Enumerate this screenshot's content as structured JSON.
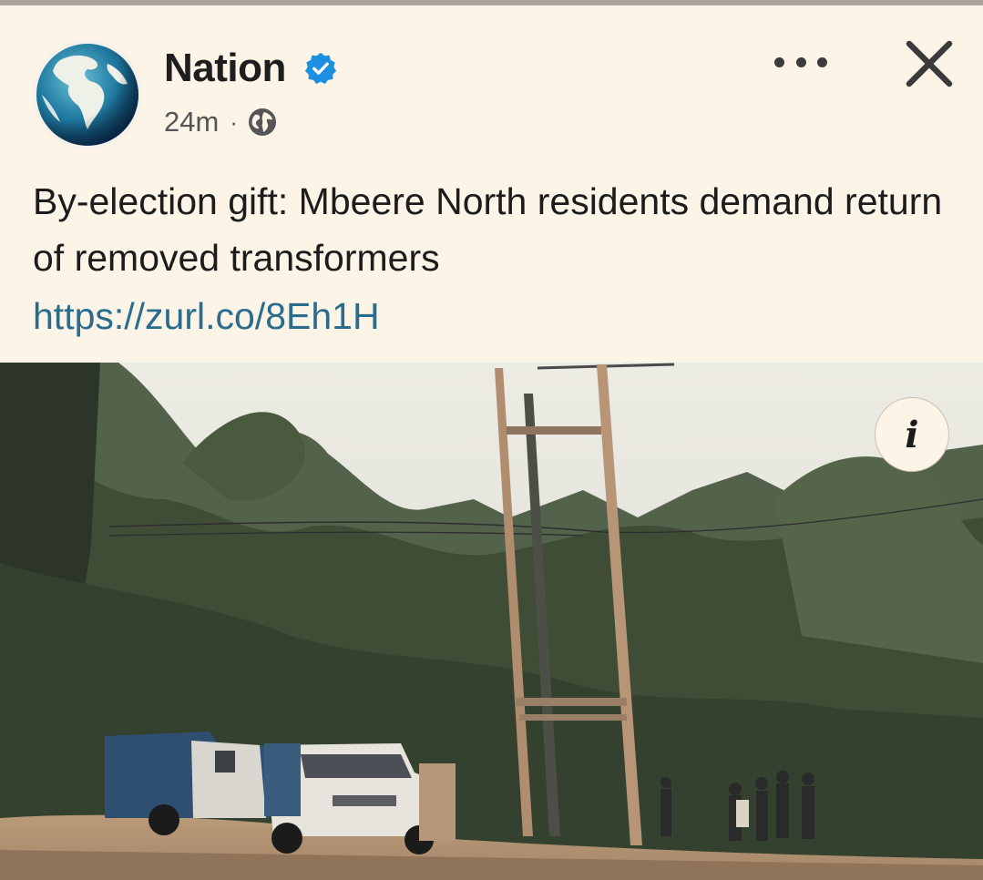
{
  "post": {
    "page_name": "Nation",
    "verified": true,
    "time_ago": "24m",
    "separator": "·",
    "audience_icon": "globe-icon",
    "text": "By-election gift: Mbeere North residents demand return of removed transformers",
    "link": "https://zurl.co/8Eh1H"
  },
  "header_actions": {
    "more_icon": "more-options-icon",
    "close_icon": "close-icon"
  },
  "photo": {
    "info_label": "i",
    "subject": "roadside-power-poles-vehicles-trees"
  },
  "colors": {
    "background": "#fcf4e7",
    "link": "#2a6c8e",
    "verified_badge": "#1d8fe0",
    "text": "#1c1c1c"
  }
}
